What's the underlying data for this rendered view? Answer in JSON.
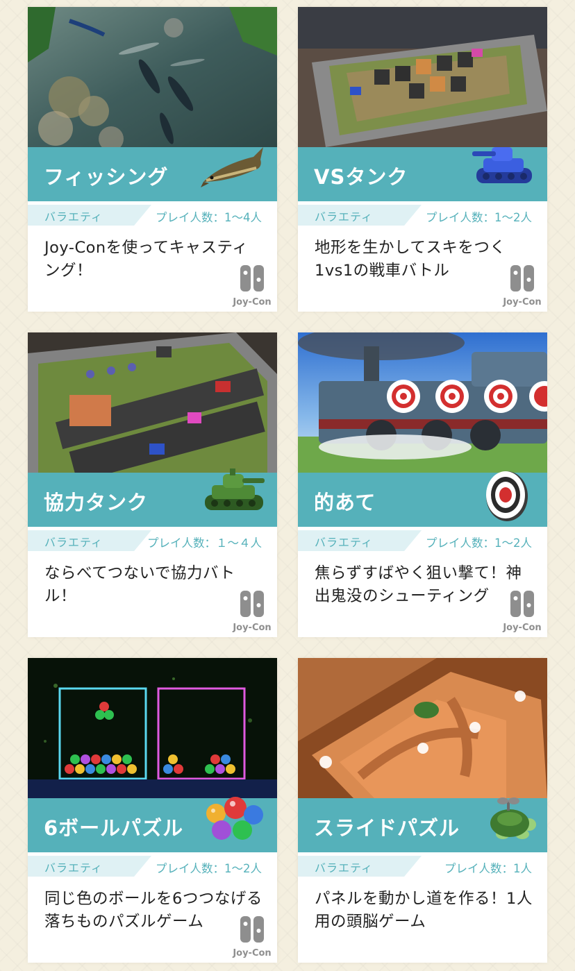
{
  "colors": {
    "accent": "#55b1ba",
    "accent_light": "#dff1f4",
    "background": "#f4efdf"
  },
  "cards": [
    {
      "title": "フィッシング",
      "genre": "バラエティ",
      "players": "プレイ人数：1〜4人",
      "description": "Joy-Conを使ってキャスティング！",
      "controller_label": "Joy-Con",
      "icon": "fish-icon"
    },
    {
      "title": "VSタンク",
      "genre": "バラエティ",
      "players": "プレイ人数：1〜2人",
      "description": "地形を生かしてスキをつく1vs1の戦車バトル",
      "controller_label": "Joy-Con",
      "icon": "blue-tank-icon"
    },
    {
      "title": "協力タンク",
      "genre": "バラエティ",
      "players": "プレイ人数：１〜４人",
      "description": "ならべてつないで協力バトル！",
      "controller_label": "Joy-Con",
      "icon": "green-tank-icon"
    },
    {
      "title": "的あて",
      "genre": "バラエティ",
      "players": "プレイ人数：1〜2人",
      "description": "焦らずすばやく狙い撃て！神出鬼没のシューティング",
      "controller_label": "Joy-Con",
      "icon": "target-icon"
    },
    {
      "title": "6ボールパズル",
      "genre": "バラエティ",
      "players": "プレイ人数：1〜2人",
      "description": "同じ色のボールを6つつなげる落ちものパズルゲーム",
      "controller_label": "Joy-Con",
      "icon": "balls-icon"
    },
    {
      "title": "スライドパズル",
      "genre": "バラエティ",
      "players": "プレイ人数：1人",
      "description": "パネルを動かし道を作る！1人用の頭脳ゲーム",
      "controller_label": "",
      "icon": "turtle-icon"
    }
  ]
}
